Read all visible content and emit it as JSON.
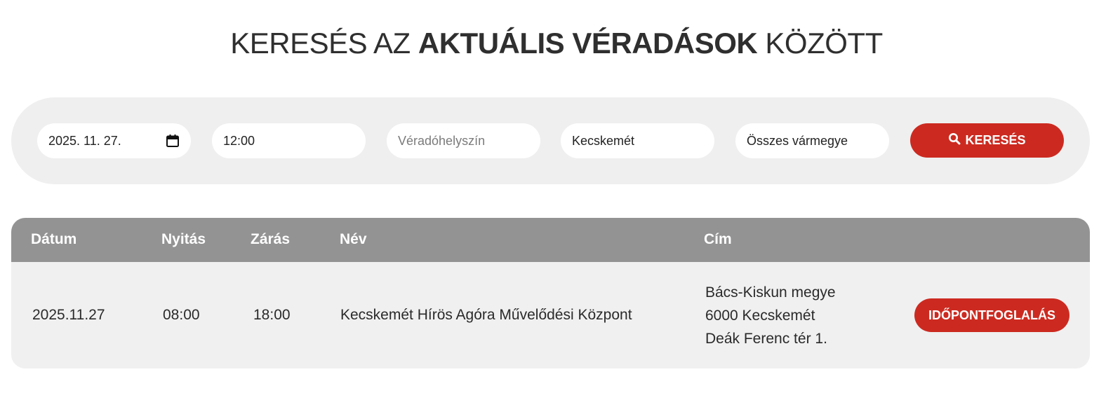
{
  "title": {
    "prefix": "KERESÉS AZ",
    "highlight": "AKTUÁLIS VÉRADÁSOK",
    "suffix": "KÖZÖTT"
  },
  "search": {
    "date_value": "2025. 11. 27.",
    "time_value": "12:00",
    "location_placeholder": "Véradóhelyszín",
    "city_value": "Kecskemét",
    "county_value": "Összes vármegye",
    "button_label": "KERESÉS",
    "button_icon": "search-icon",
    "calendar_icon": "calendar-icon"
  },
  "table": {
    "headers": {
      "date": "Dátum",
      "open": "Nyitás",
      "close": "Zárás",
      "name": "Név",
      "address": "Cím"
    },
    "rows": [
      {
        "date": "2025.11.27",
        "open": "08:00",
        "close": "18:00",
        "name": "Kecskemét Hírös Agóra Művelődési Központ",
        "address_lines": [
          "Bács-Kiskun megye",
          "6000 Kecskemét",
          "Deák Ferenc tér 1."
        ],
        "action_label": "IDŐPONTFOGLALÁS"
      }
    ]
  },
  "colors": {
    "accent": "#cc2a20",
    "panel_bg": "#efefef",
    "header_bg": "#939393",
    "row_bg": "#f0f0f0"
  }
}
